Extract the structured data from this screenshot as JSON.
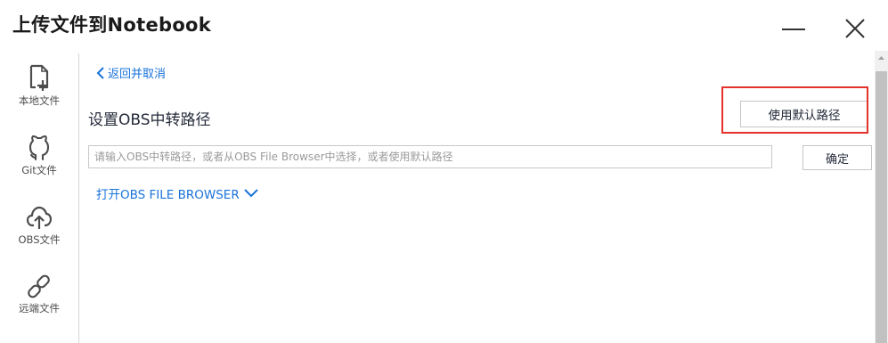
{
  "window": {
    "title": "上传文件到Notebook"
  },
  "sidebar": {
    "items": [
      {
        "label": "本地文件",
        "icon": "local-file-icon"
      },
      {
        "label": "Git文件",
        "icon": "github-icon"
      },
      {
        "label": "OBS文件",
        "icon": "cloud-upload-icon"
      },
      {
        "label": "远端文件",
        "icon": "link-icon"
      }
    ]
  },
  "main": {
    "back_label": "返回并取消",
    "section_title": "设置OBS中转路径",
    "default_path_button": "使用默认路径",
    "path_input": {
      "placeholder": "请输入OBS中转路径，或者从OBS File Browser中选择，或者使用默认路径",
      "value": ""
    },
    "confirm_button": "确定",
    "open_browser_label": "打开OBS FILE BROWSER"
  },
  "colors": {
    "link": "#1a73d9",
    "highlight": "#e4312b",
    "border": "#c6c6c6"
  }
}
